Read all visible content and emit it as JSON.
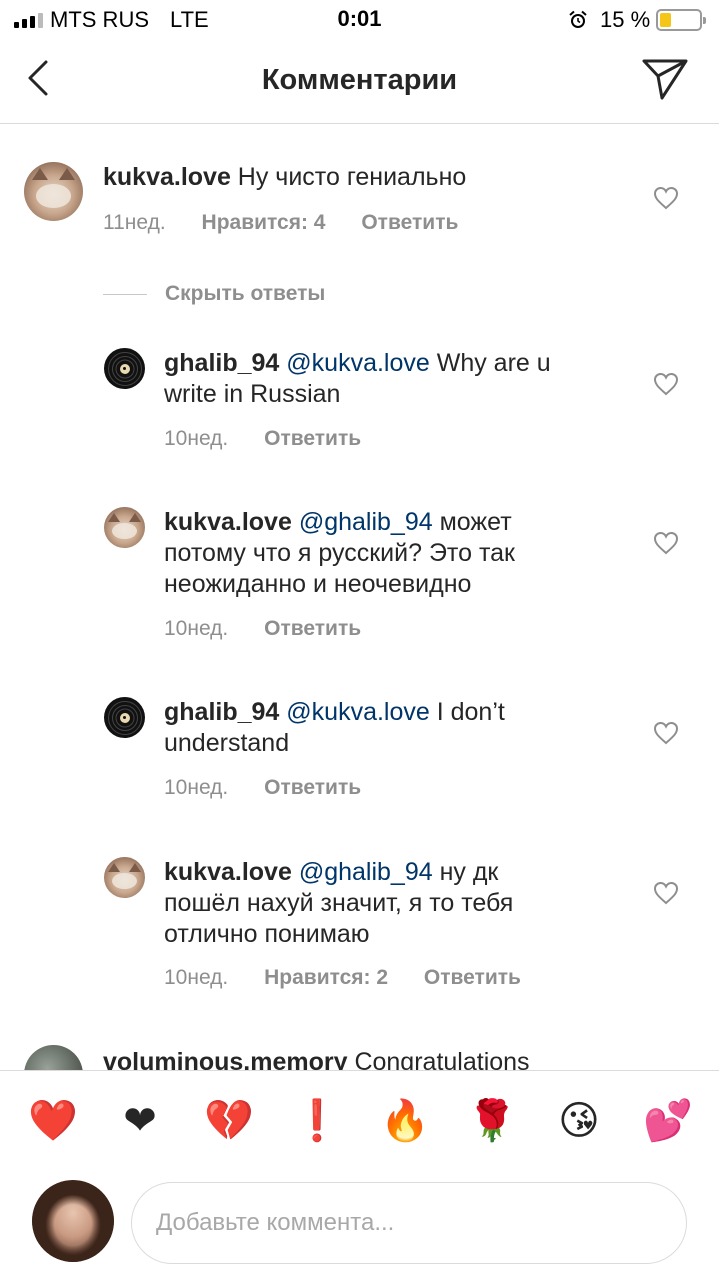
{
  "status_bar": {
    "carrier": "MTS RUS",
    "network": "LTE",
    "time": "0:01",
    "battery_pct_text": "15 %",
    "battery_level": 0.15,
    "battery_color": "#f5c518"
  },
  "header": {
    "title": "Комментарии",
    "back_icon": "chevron-left-icon",
    "send_icon": "paper-plane-icon"
  },
  "comments": [
    {
      "username": "kukva.love",
      "text": " Ну чисто гениально",
      "time": "11нед.",
      "likes": "Нравится: 4",
      "reply": "Ответить",
      "avatar": "cat-avatar"
    }
  ],
  "hide_replies": "Скрыть ответы",
  "replies": [
    {
      "username": "ghalib_94",
      "mention": "@kukva.love",
      "line1_rest": " Why are u",
      "line2": "write in Russian",
      "time": "10нед.",
      "reply": "Ответить",
      "avatar": "vinyl-record-avatar"
    },
    {
      "username": "kukva.love",
      "mention": "@ghalib_94",
      "line1_rest": " может",
      "line2": "потому что я русский? Это так",
      "line3": "неожиданно и неочевидно",
      "time": "10нед.",
      "reply": "Ответить",
      "avatar": "cat-avatar"
    },
    {
      "username": "ghalib_94",
      "mention": "@kukva.love",
      "line1_rest": " I don’t",
      "line2": "understand",
      "time": "10нед.",
      "reply": "Ответить",
      "avatar": "vinyl-record-avatar"
    },
    {
      "username": "kukva.love",
      "mention": "@ghalib_94",
      "line1_rest": " ну дк",
      "line2": "пошёл нахуй значит, я то тебя",
      "line3": "отлично понимаю",
      "time": "10нед.",
      "likes": "Нравится: 2",
      "reply": "Ответить",
      "avatar": "cat-avatar"
    }
  ],
  "next_comment": {
    "username": "voluminous.memory",
    "text": " Congratulations"
  },
  "emoji_bar": [
    "❤️",
    "❤",
    "💔",
    "❗",
    "🔥",
    "🌹",
    "😘",
    "💕"
  ],
  "input": {
    "placeholder": "Добавьте коммента..."
  },
  "colors": {
    "mention": "#003569",
    "meta": "#8e8e8e",
    "text": "#262626",
    "divider": "#dbdbdb"
  }
}
